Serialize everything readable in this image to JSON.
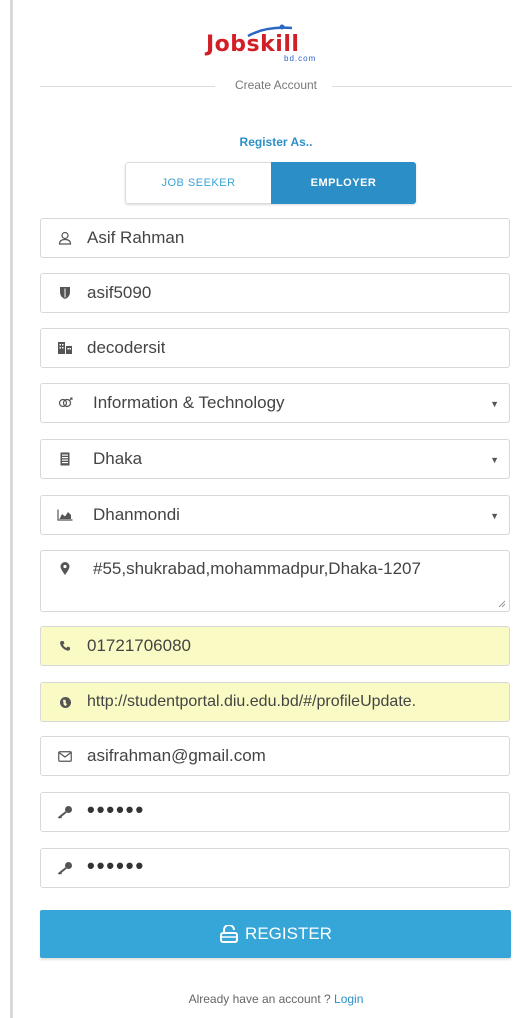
{
  "logo": {
    "text": "Jobskill",
    "subtext": "bd.com"
  },
  "divider_text": "Create Account",
  "register_as": "Register As..",
  "account_type": {
    "options": [
      "JOB SEEKER",
      "EMPLOYER"
    ],
    "selected": "EMPLOYER"
  },
  "fields": {
    "full_name": {
      "value": "Asif Rahman",
      "icon": "user-icon"
    },
    "username": {
      "value": "asif5090",
      "icon": "shield-icon"
    },
    "company": {
      "value": "decodersit",
      "icon": "building-icon"
    },
    "industry": {
      "value": "Information & Technology",
      "icon": "gender-icon"
    },
    "city": {
      "value": "Dhaka",
      "icon": "building-icon"
    },
    "area": {
      "value": "Dhanmondi",
      "icon": "area-chart-icon"
    },
    "address": {
      "value": "#55,shukrabad,mohammadpur,Dhaka-1207",
      "icon": "map-marker-icon"
    },
    "phone": {
      "value": "01721706080",
      "icon": "phone-icon"
    },
    "website": {
      "value": "http://studentportal.diu.edu.bd/#/profileUpdate.",
      "icon": "globe-icon"
    },
    "email": {
      "value": "asifrahman@gmail.com",
      "icon": "envelope-icon"
    },
    "password": {
      "value": "••••••",
      "icon": "key-icon"
    },
    "confirm_password": {
      "value": "••••••",
      "icon": "key-icon"
    }
  },
  "register_button": "REGISTER",
  "footer": {
    "text": "Already have an account ?",
    "link": "Login"
  },
  "colors": {
    "accent": "#35a6d7",
    "toggle_active": "#2b8ec7",
    "autofill": "#fafac4",
    "logo_red": "#d21f27"
  }
}
